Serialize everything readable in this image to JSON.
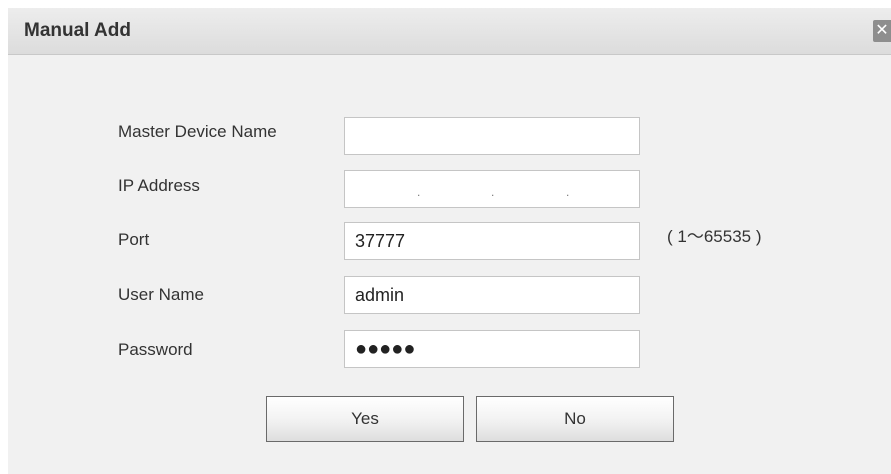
{
  "dialog": {
    "title": "Manual Add",
    "close_symbol": "✕"
  },
  "form": {
    "master_device_name": {
      "label": "Master Device Name",
      "value": ""
    },
    "ip_address": {
      "label": "IP Address",
      "separator": "."
    },
    "port": {
      "label": "Port",
      "value": "37777",
      "range_hint": "( 1～65535 )"
    },
    "user_name": {
      "label": "User Name",
      "value": "admin"
    },
    "password": {
      "label": "Password",
      "masked_value": "●●●●●"
    }
  },
  "buttons": {
    "yes_label": "Yes",
    "no_label": "No"
  },
  "colors": {
    "dialog_background": "#f1f1f1",
    "title_bar": "#e4e4e4",
    "close_button": "#8e8e8e",
    "field_border": "#c5c5c5"
  },
  "icons": {
    "close": "close-icon"
  }
}
